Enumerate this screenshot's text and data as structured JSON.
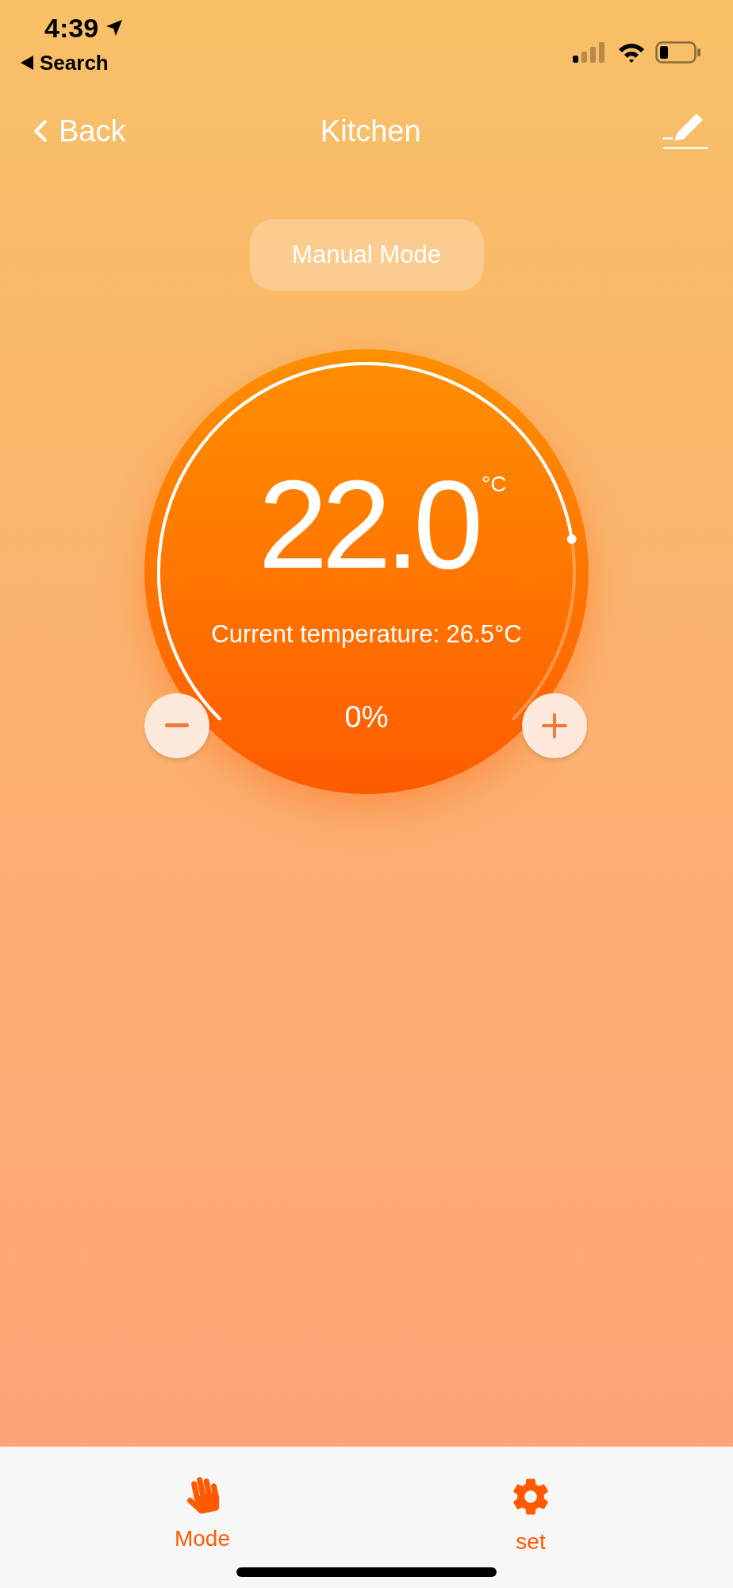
{
  "status_bar": {
    "time": "4:39",
    "back_app": "Search"
  },
  "nav": {
    "back": "Back",
    "title": "Kitchen"
  },
  "mode_badge": "Manual Mode",
  "thermostat": {
    "setpoint": "22.0",
    "unit": "°C",
    "current": "Current temperature: 26.5°C",
    "output": "0%"
  },
  "tab_bar": [
    {
      "label": "Mode",
      "kind": "hand"
    },
    {
      "label": "set",
      "kind": "gear"
    }
  ]
}
